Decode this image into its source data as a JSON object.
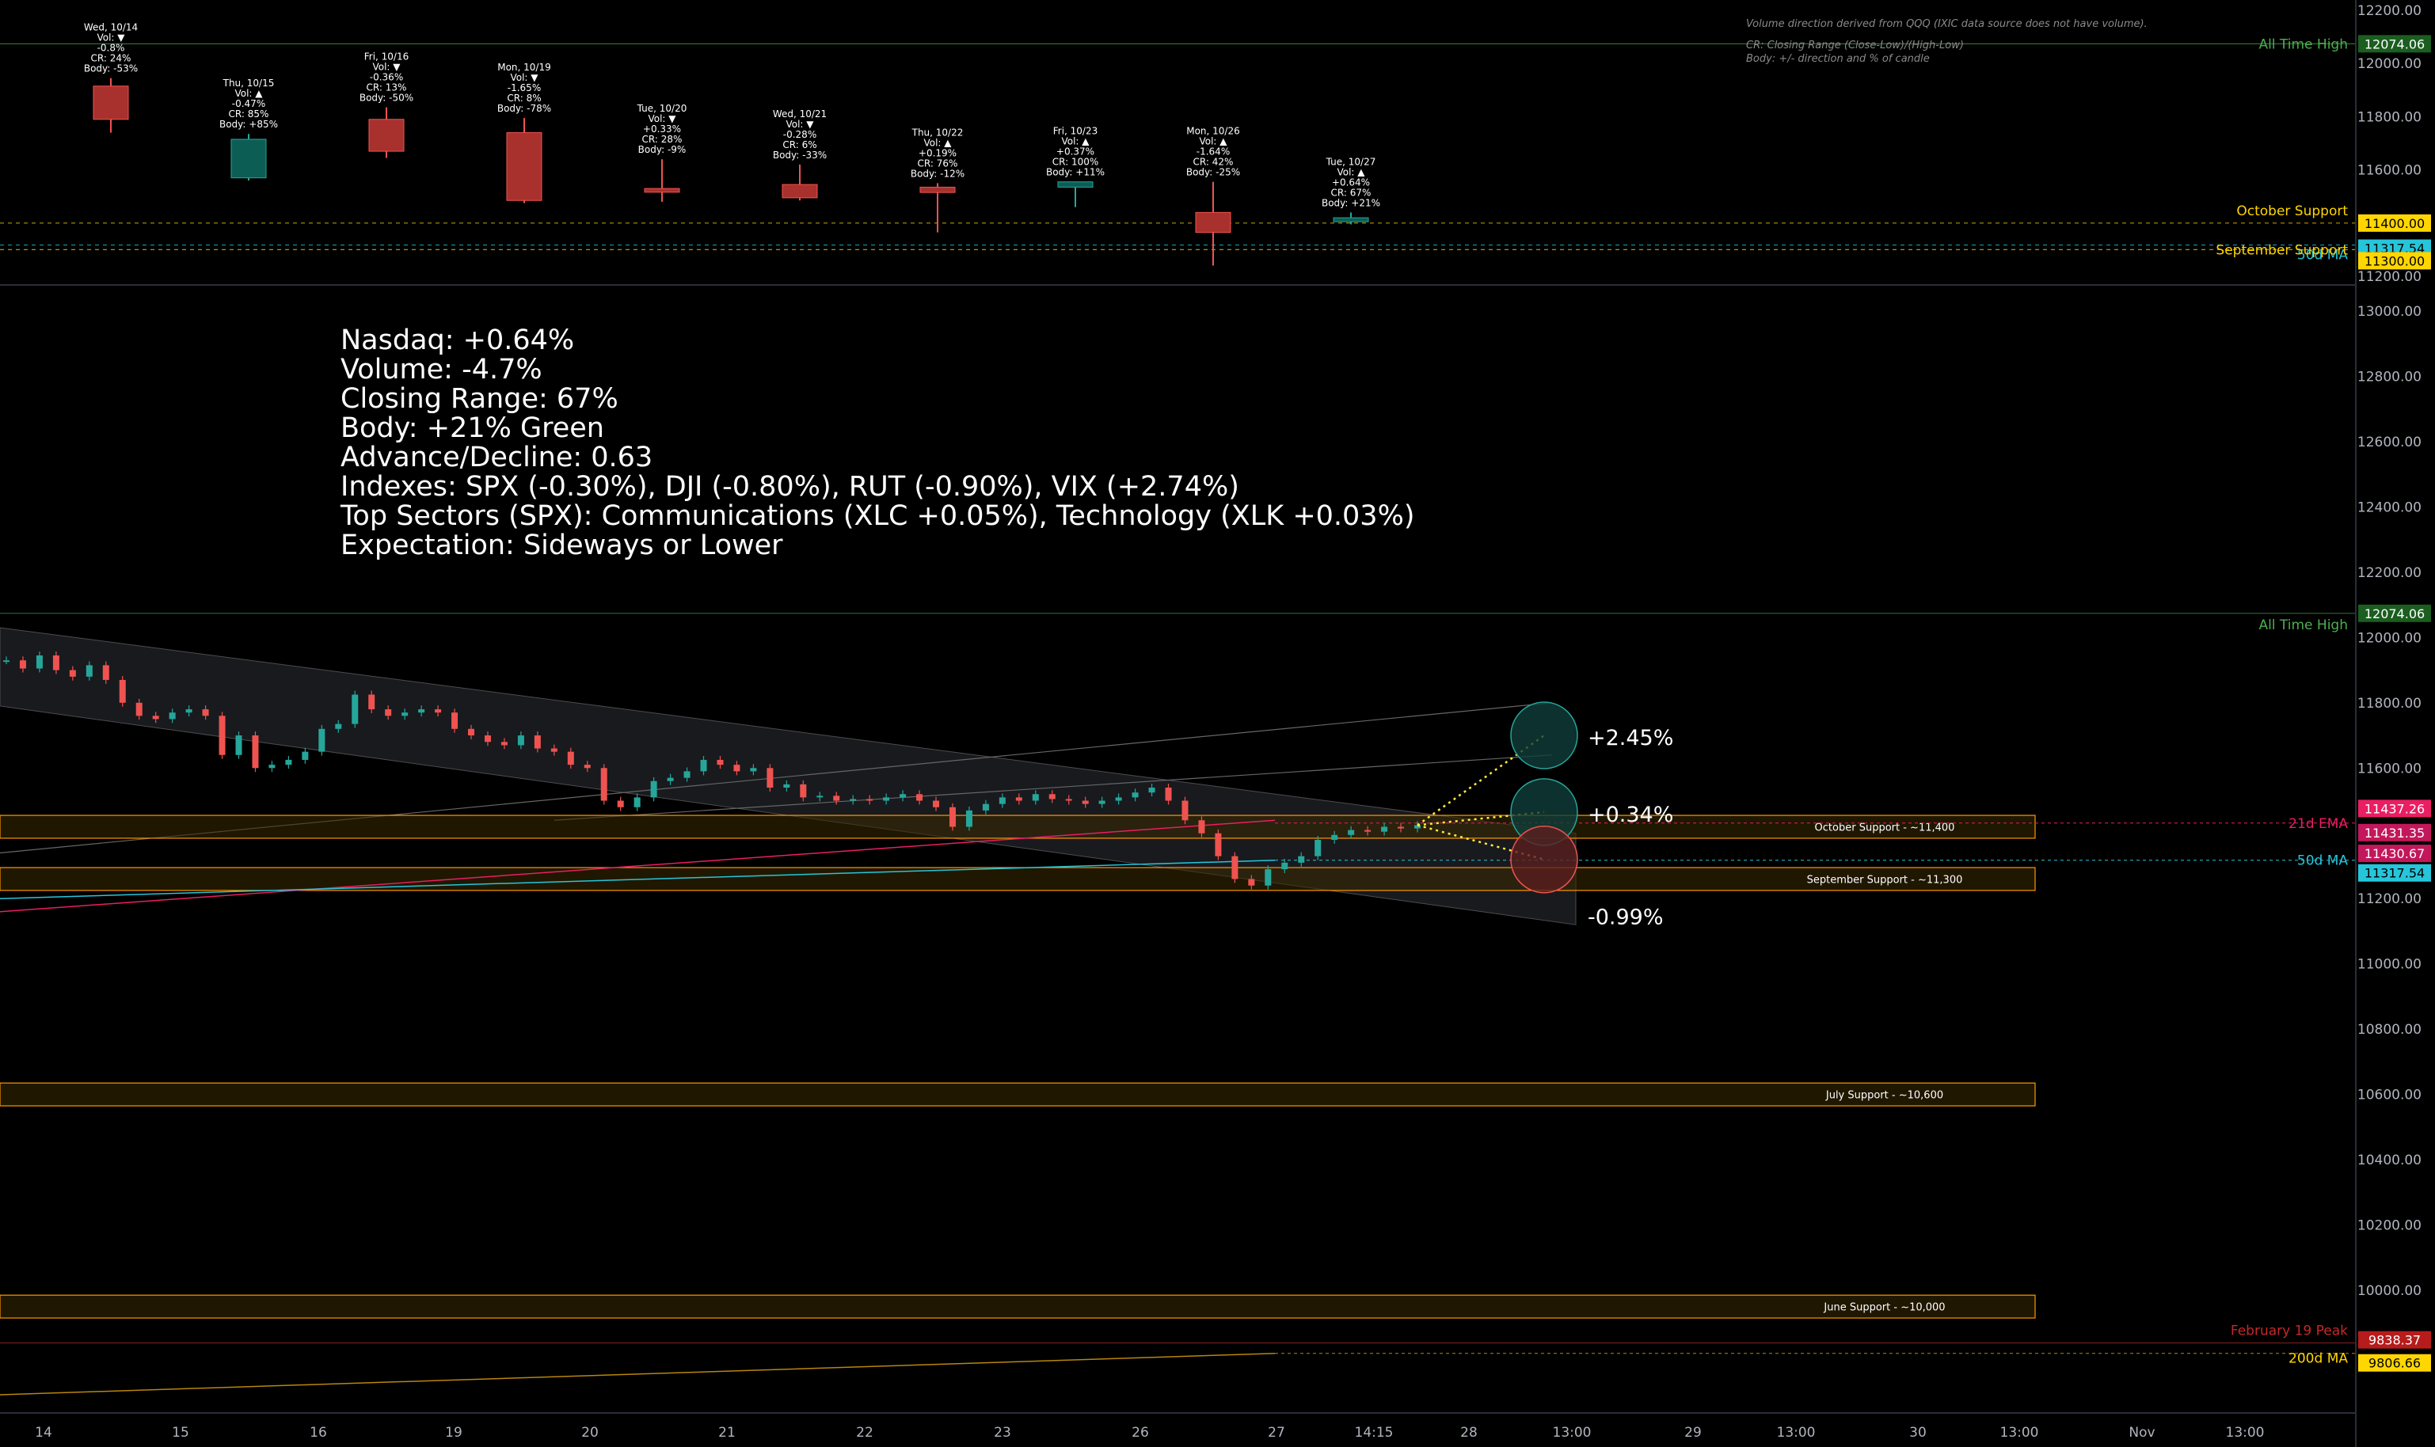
{
  "note": {
    "line1": "Volume direction derived from QQQ (IXIC data source does not have volume).",
    "line2": "CR: Closing Range (Close-Low)/(High-Low)",
    "line3": "Body: +/- direction and % of candle"
  },
  "summary": {
    "nasdaq": "Nasdaq: +0.64%",
    "volume": "Volume: -4.7%",
    "closing_range": "Closing Range: 67%",
    "body": "Body: +21% Green",
    "advance_decline": "Advance/Decline: 0.63",
    "indexes": "Indexes: SPX (-0.30%), DJI (-0.80%), RUT (-0.90%), VIX (+2.74%)",
    "top_sectors": "Top Sectors (SPX): Communications (XLC +0.05%), Technology (XLK +0.03%)",
    "expectation": "Expectation: Sideways or Lower"
  },
  "colors": {
    "up": "#26a69a",
    "down": "#ef5350",
    "up_fill": "#0c5e55",
    "down_fill": "#a8302d",
    "support": "#ffd600",
    "ma50": "#26c6da",
    "ema21": "#e91e63",
    "ath": "#4caf50",
    "peak": "#c62828",
    "zone_border": "#ff9800",
    "projection": "#ffeb3b"
  },
  "chart_data": [
    {
      "type": "candlestick",
      "title": "",
      "ylim": [
        11200,
        12200
      ],
      "y_ticks": [
        "12200.00",
        "12000.00",
        "11800.00",
        "11600.00",
        "11400.00",
        "11200.00"
      ],
      "candles": [
        {
          "label": [
            "Wed, 10/14",
            "Vol: ▼",
            "-0.8%",
            "CR: 24%",
            "Body: -53%"
          ],
          "open": 11915,
          "high": 11945,
          "low": 11740,
          "close": 11790,
          "direction": "down"
        },
        {
          "label": [
            "Thu, 10/15",
            "Vol: ▲",
            "-0.47%",
            "CR: 85%",
            "Body: +85%"
          ],
          "open": 11570,
          "high": 11735,
          "low": 11560,
          "close": 11715,
          "direction": "up"
        },
        {
          "label": [
            "Fri, 10/16",
            "Vol: ▼",
            "-0.36%",
            "CR: 13%",
            "Body: -50%"
          ],
          "open": 11790,
          "high": 11835,
          "low": 11645,
          "close": 11670,
          "direction": "down"
        },
        {
          "label": [
            "Mon, 10/19",
            "Vol: ▼",
            "-1.65%",
            "CR: 8%",
            "Body: -78%"
          ],
          "open": 11740,
          "high": 11795,
          "low": 11475,
          "close": 11485,
          "direction": "down"
        },
        {
          "label": [
            "Tue, 10/20",
            "Vol: ▼",
            "+0.33%",
            "CR: 28%",
            "Body: -9%"
          ],
          "open": 11530,
          "high": 11640,
          "low": 11480,
          "close": 11516,
          "direction": "down"
        },
        {
          "label": [
            "Wed, 10/21",
            "Vol: ▼",
            "-0.28%",
            "CR: 6%",
            "Body: -33%"
          ],
          "open": 11545,
          "high": 11620,
          "low": 11485,
          "close": 11495,
          "direction": "down"
        },
        {
          "label": [
            "Thu, 10/22",
            "Vol: ▲",
            "+0.19%",
            "CR: 76%",
            "Body: -12%"
          ],
          "open": 11535,
          "high": 11550,
          "low": 11365,
          "close": 11515,
          "direction": "down"
        },
        {
          "label": [
            "Fri, 10/23",
            "Vol: ▲",
            "+0.37%",
            "CR: 100%",
            "Body: +11%"
          ],
          "open": 11535,
          "high": 11555,
          "low": 11460,
          "close": 11555,
          "direction": "up"
        },
        {
          "label": [
            "Mon, 10/26",
            "Vol: ▲",
            "-1.64%",
            "CR: 42%",
            "Body: -25%"
          ],
          "open": 11440,
          "high": 11555,
          "low": 11240,
          "close": 11365,
          "direction": "down"
        },
        {
          "label": [
            "Tue, 10/27",
            "Vol: ▲",
            "+0.64%",
            "CR: 67%",
            "Body: +21%"
          ],
          "open": 11405,
          "high": 11440,
          "low": 11395,
          "close": 11420,
          "direction": "up"
        }
      ],
      "levels": [
        {
          "name": "All Time High",
          "value": 12074.06,
          "color": "#4caf50"
        },
        {
          "name": "October Support",
          "value": 11400.0,
          "color": "#ffd600"
        },
        {
          "name": "50d MA",
          "value": 11317.54,
          "color": "#26c6da"
        },
        {
          "name": "September Support",
          "value": 11300.0,
          "color": "#ffd600"
        }
      ]
    },
    {
      "type": "line",
      "title": "",
      "ylim": [
        9700,
        13200
      ],
      "y_ticks": [
        "13000.00",
        "12800.00",
        "12600.00",
        "12400.00",
        "12200.00",
        "12000.00",
        "11800.00",
        "11600.00",
        "11400.00",
        "11200.00",
        "11000.00",
        "10800.00",
        "10600.00",
        "10400.00",
        "10200.00",
        "10000.00"
      ],
      "x_ticks": [
        "14",
        "15",
        "16",
        "19",
        "20",
        "21",
        "22",
        "23",
        "26",
        "27",
        "14:15",
        "28",
        "13:00",
        "29",
        "13:00",
        "30",
        "13:00",
        "Nov",
        "13:00"
      ],
      "series": [
        {
          "values": [
            11930,
            11905,
            11945,
            11900,
            11880,
            11915,
            11870,
            11800,
            11760,
            11750,
            11770,
            11780,
            11760,
            11640,
            11700,
            11600,
            11610,
            11625,
            11650,
            11720,
            11735,
            11825,
            11780,
            11760,
            11770,
            11780,
            11770,
            11720,
            11700,
            11680,
            11670,
            11700,
            11660,
            11650,
            11610,
            11600,
            11500,
            11480,
            11510,
            11560,
            11570,
            11590,
            11625,
            11610,
            11590,
            11600,
            11540,
            11550,
            11510,
            11515,
            11500,
            11505,
            11500,
            11510,
            11520,
            11500,
            11480,
            11420,
            11470,
            11490,
            11510,
            11500,
            11520,
            11505,
            11500,
            11490,
            11500,
            11510,
            11525,
            11540,
            11500,
            11440,
            11400,
            11330,
            11260,
            11240,
            11290,
            11310,
            11330,
            11380,
            11395,
            11410,
            11405,
            11420,
            11415,
            11425
          ]
        }
      ],
      "levels": [
        {
          "name": "All Time High",
          "value": 12074.06,
          "color": "#4caf50"
        },
        {
          "name": "21d EMA",
          "value": 11431.35,
          "color": "#e91e63"
        },
        {
          "name": "50d MA",
          "value": 11317.54,
          "color": "#26c6da"
        },
        {
          "name": "February 19 Peak",
          "value": 9838.37,
          "color": "#c62828"
        },
        {
          "name": "200d MA",
          "value": 9806.66,
          "color": "#ffd600"
        }
      ],
      "price_tags": [
        "11437.26",
        "11431.35",
        "11430.67",
        "11317.54"
      ],
      "zones": [
        {
          "label": "October Support - ~11,400",
          "low": 11385,
          "high": 11455
        },
        {
          "label": "September Support - ~11,300",
          "low": 11225,
          "high": 11295
        },
        {
          "label": "July Support - ~10,600",
          "low": 10565,
          "high": 10635
        },
        {
          "label": "June Support - ~10,000",
          "low": 9915,
          "high": 9985
        }
      ],
      "projections": [
        {
          "label": "+2.45%",
          "value": 11700
        },
        {
          "label": "+0.34%",
          "value": 11465
        },
        {
          "label": "-0.99%",
          "value": 11320
        }
      ]
    }
  ]
}
